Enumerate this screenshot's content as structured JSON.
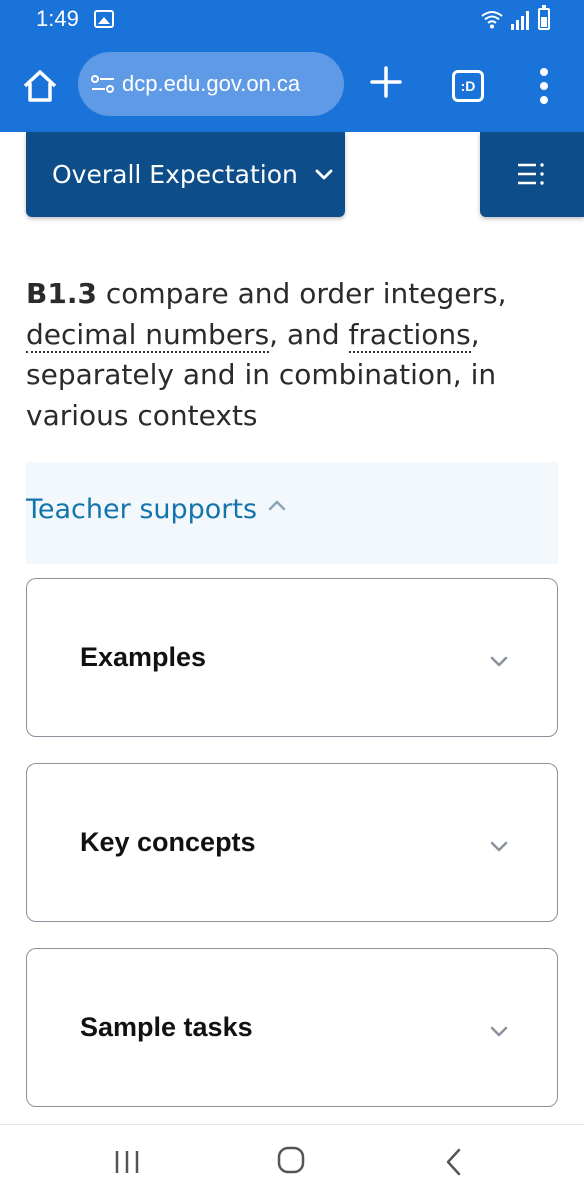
{
  "status_bar": {
    "time": "1:49",
    "icons": [
      "gallery-icon",
      "wifi-icon",
      "signal-icon",
      "battery-icon"
    ]
  },
  "browser": {
    "url": "dcp.edu.gov.on.ca",
    "tab_count_label": ":D",
    "toolbar_color": "#1a73d8",
    "url_bar_color": "#5e9ae6",
    "icons": [
      "home-icon",
      "site-settings-icon",
      "new-tab-icon",
      "tabs-icon",
      "more-menu-icon"
    ]
  },
  "page": {
    "expectation_button": {
      "label": "Overall Expectation",
      "icon": "chevron-down-icon",
      "color": "#0d4d8a"
    },
    "list_button": {
      "icon": "list-menu-icon"
    },
    "expectation": {
      "code": "B1.3",
      "text_1": " compare and order integers, ",
      "term_1": "decimal numbers",
      "text_2": ", and ",
      "term_2": "fractions",
      "text_3": ", separately and in combination, in various contexts"
    },
    "teacher_supports": {
      "label": "Teacher supports",
      "icon": "chevron-up-icon",
      "link_color": "#1474ac"
    },
    "accordions": [
      {
        "title": "Examples",
        "icon": "chevron-down-icon"
      },
      {
        "title": "Key concepts",
        "icon": "chevron-down-icon"
      },
      {
        "title": "Sample tasks",
        "icon": "chevron-down-icon"
      }
    ]
  },
  "nav_bar": {
    "icons": [
      "recents-icon",
      "home-icon",
      "back-icon"
    ]
  }
}
